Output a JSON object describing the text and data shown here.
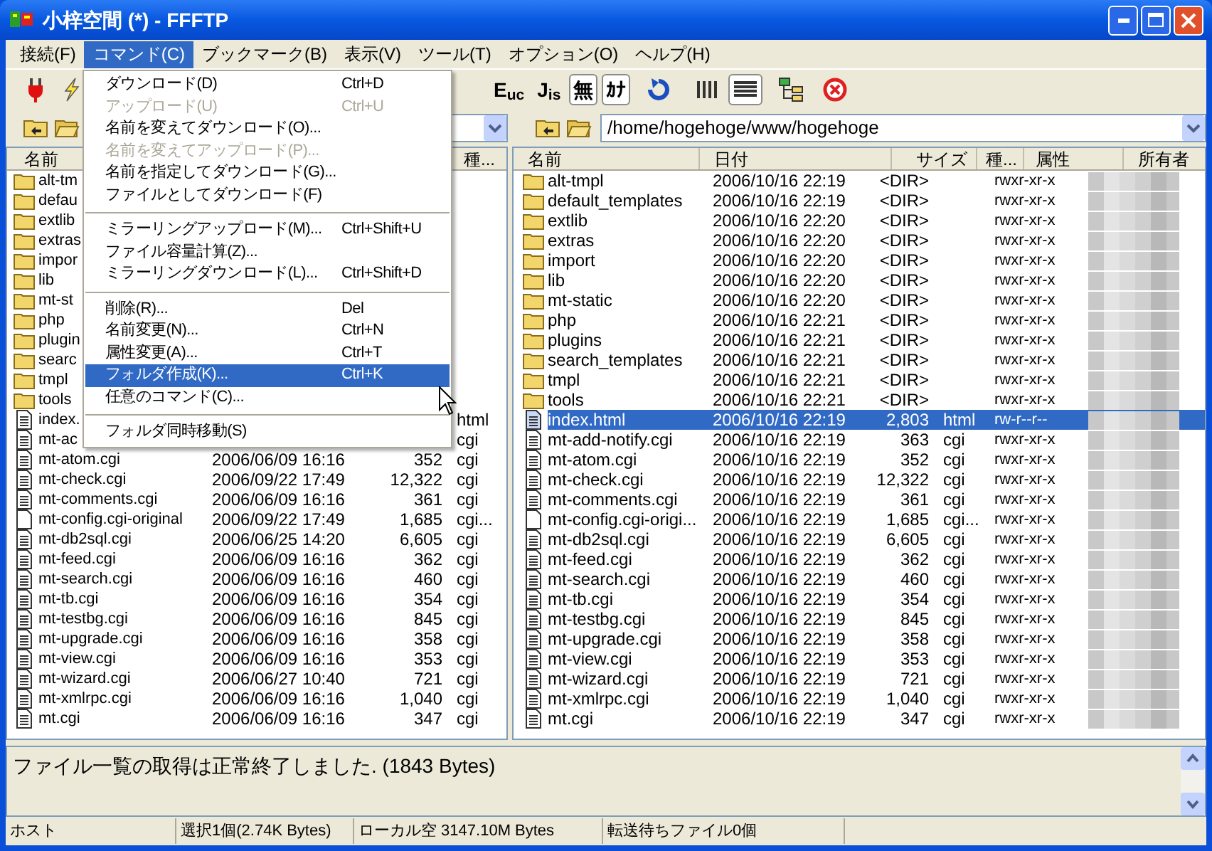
{
  "window": {
    "title": "小梓空間 (*) - FFFTP"
  },
  "menu_bar": [
    {
      "label": "接続(F)",
      "selected": false
    },
    {
      "label": "コマンド(C)",
      "selected": true
    },
    {
      "label": "ブックマーク(B)",
      "selected": false
    },
    {
      "label": "表示(V)",
      "selected": false
    },
    {
      "label": "ツール(T)",
      "selected": false
    },
    {
      "label": "オプション(O)",
      "selected": false
    },
    {
      "label": "ヘルプ(H)",
      "selected": false
    }
  ],
  "command_menu": [
    {
      "kind": "item",
      "label": "ダウンロード(D)",
      "shortcut": "Ctrl+D",
      "disabled": false,
      "selected": false
    },
    {
      "kind": "item",
      "label": "アップロード(U)",
      "shortcut": "Ctrl+U",
      "disabled": true,
      "selected": false
    },
    {
      "kind": "item",
      "label": "名前を変えてダウンロード(O)...",
      "disabled": false,
      "selected": false
    },
    {
      "kind": "item",
      "label": "名前を変えてアップロード(P)...",
      "disabled": true,
      "selected": false
    },
    {
      "kind": "item",
      "label": "名前を指定してダウンロード(G)...",
      "disabled": false,
      "selected": false
    },
    {
      "kind": "item",
      "label": "ファイルとしてダウンロード(F)",
      "disabled": false,
      "selected": false
    },
    {
      "kind": "separator"
    },
    {
      "kind": "item",
      "label": "ミラーリングアップロード(M)...",
      "shortcut": "Ctrl+Shift+U",
      "disabled": false,
      "selected": false
    },
    {
      "kind": "item",
      "label": "ファイル容量計算(Z)...",
      "disabled": false,
      "selected": false
    },
    {
      "kind": "item",
      "label": "ミラーリングダウンロード(L)...",
      "shortcut": "Ctrl+Shift+D",
      "disabled": false,
      "selected": false
    },
    {
      "kind": "separator"
    },
    {
      "kind": "item",
      "label": "削除(R)...",
      "shortcut": "Del",
      "disabled": false,
      "selected": false
    },
    {
      "kind": "item",
      "label": "名前変更(N)...",
      "shortcut": "Ctrl+N",
      "disabled": false,
      "selected": false
    },
    {
      "kind": "item",
      "label": "属性変更(A)...",
      "shortcut": "Ctrl+T",
      "disabled": false,
      "selected": false
    },
    {
      "kind": "item",
      "label": "フォルダ作成(K)...",
      "shortcut": "Ctrl+K",
      "disabled": false,
      "selected": true
    },
    {
      "kind": "item",
      "label": "任意のコマンド(C)...",
      "disabled": false,
      "selected": false
    },
    {
      "kind": "separator"
    },
    {
      "kind": "item",
      "label": "フォルダ同時移動(S)",
      "disabled": false,
      "selected": false
    }
  ],
  "encoding_buttons": [
    {
      "label": "E$_{uc}$",
      "pressed": false
    },
    {
      "label": "J$_{is}$",
      "pressed": false
    },
    {
      "label": "無",
      "pressed": true
    },
    {
      "label": "ｶﾅ",
      "pressed": true
    }
  ],
  "view_buttons": [
    {
      "kind": "list",
      "pressed": false
    },
    {
      "kind": "details",
      "pressed": true
    }
  ],
  "local_pane": {
    "columns": [
      "名前",
      "種..."
    ],
    "rows": [
      {
        "kind": "folder",
        "name": "alt-tm"
      },
      {
        "kind": "folder",
        "name": "defau"
      },
      {
        "kind": "folder",
        "name": "extlib"
      },
      {
        "kind": "folder",
        "name": "extras"
      },
      {
        "kind": "folder",
        "name": "impor"
      },
      {
        "kind": "folder",
        "name": "lib"
      },
      {
        "kind": "folder",
        "name": "mt-st"
      },
      {
        "kind": "folder",
        "name": "php"
      },
      {
        "kind": "folder",
        "name": "plugin"
      },
      {
        "kind": "folder",
        "name": "searc"
      },
      {
        "kind": "folder",
        "name": "tmpl"
      },
      {
        "kind": "folder",
        "name": "tools"
      },
      {
        "kind": "file",
        "name": "index.",
        "type": "html"
      },
      {
        "kind": "file",
        "name": "mt-ac",
        "type": "cgi"
      },
      {
        "kind": "file",
        "name": "mt-atom.cgi",
        "date": "2006/06/09 16:16",
        "size": "352",
        "type": "cgi"
      },
      {
        "kind": "file",
        "name": "mt-check.cgi",
        "date": "2006/09/22 17:49",
        "size": "12,322",
        "type": "cgi"
      },
      {
        "kind": "file",
        "name": "mt-comments.cgi",
        "date": "2006/06/09 16:16",
        "size": "361",
        "type": "cgi"
      },
      {
        "kind": "blank",
        "name": "mt-config.cgi-original",
        "date": "2006/09/22 17:49",
        "size": "1,685",
        "type": "cgi..."
      },
      {
        "kind": "file",
        "name": "mt-db2sql.cgi",
        "date": "2006/06/25 14:20",
        "size": "6,605",
        "type": "cgi"
      },
      {
        "kind": "file",
        "name": "mt-feed.cgi",
        "date": "2006/06/09 16:16",
        "size": "362",
        "type": "cgi"
      },
      {
        "kind": "file",
        "name": "mt-search.cgi",
        "date": "2006/06/09 16:16",
        "size": "460",
        "type": "cgi"
      },
      {
        "kind": "file",
        "name": "mt-tb.cgi",
        "date": "2006/06/09 16:16",
        "size": "354",
        "type": "cgi"
      },
      {
        "kind": "file",
        "name": "mt-testbg.cgi",
        "date": "2006/06/09 16:16",
        "size": "845",
        "type": "cgi"
      },
      {
        "kind": "file",
        "name": "mt-upgrade.cgi",
        "date": "2006/06/09 16:16",
        "size": "358",
        "type": "cgi"
      },
      {
        "kind": "file",
        "name": "mt-view.cgi",
        "date": "2006/06/09 16:16",
        "size": "353",
        "type": "cgi"
      },
      {
        "kind": "file",
        "name": "mt-wizard.cgi",
        "date": "2006/06/27 10:40",
        "size": "721",
        "type": "cgi"
      },
      {
        "kind": "file",
        "name": "mt-xmlrpc.cgi",
        "date": "2006/06/09 16:16",
        "size": "1,040",
        "type": "cgi"
      },
      {
        "kind": "file",
        "name": "mt.cgi",
        "date": "2006/06/09 16:16",
        "size": "347",
        "type": "cgi"
      }
    ]
  },
  "remote_pane": {
    "path": "/home/hogehoge/www/hogehoge",
    "columns": [
      "名前",
      "日付",
      "サイズ",
      "種...",
      "属性",
      "所有者"
    ],
    "rows": [
      {
        "kind": "folder",
        "name": "alt-tmpl",
        "date": "2006/10/16 22:19",
        "size": "<DIR>",
        "attr": "rwxr-xr-x",
        "selected": false
      },
      {
        "kind": "folder",
        "name": "default_templates",
        "date": "2006/10/16 22:19",
        "size": "<DIR>",
        "attr": "rwxr-xr-x",
        "selected": false
      },
      {
        "kind": "folder",
        "name": "extlib",
        "date": "2006/10/16 22:20",
        "size": "<DIR>",
        "attr": "rwxr-xr-x",
        "selected": false
      },
      {
        "kind": "folder",
        "name": "extras",
        "date": "2006/10/16 22:20",
        "size": "<DIR>",
        "attr": "rwxr-xr-x",
        "selected": false
      },
      {
        "kind": "folder",
        "name": "import",
        "date": "2006/10/16 22:20",
        "size": "<DIR>",
        "attr": "rwxr-xr-x",
        "selected": false
      },
      {
        "kind": "folder",
        "name": "lib",
        "date": "2006/10/16 22:20",
        "size": "<DIR>",
        "attr": "rwxr-xr-x",
        "selected": false
      },
      {
        "kind": "folder",
        "name": "mt-static",
        "date": "2006/10/16 22:20",
        "size": "<DIR>",
        "attr": "rwxr-xr-x",
        "selected": false
      },
      {
        "kind": "folder",
        "name": "php",
        "date": "2006/10/16 22:21",
        "size": "<DIR>",
        "attr": "rwxr-xr-x",
        "selected": false
      },
      {
        "kind": "folder",
        "name": "plugins",
        "date": "2006/10/16 22:21",
        "size": "<DIR>",
        "attr": "rwxr-xr-x",
        "selected": false
      },
      {
        "kind": "folder",
        "name": "search_templates",
        "date": "2006/10/16 22:21",
        "size": "<DIR>",
        "attr": "rwxr-xr-x",
        "selected": false
      },
      {
        "kind": "folder",
        "name": "tmpl",
        "date": "2006/10/16 22:21",
        "size": "<DIR>",
        "attr": "rwxr-xr-x",
        "selected": false
      },
      {
        "kind": "folder",
        "name": "tools",
        "date": "2006/10/16 22:21",
        "size": "<DIR>",
        "attr": "rwxr-xr-x",
        "selected": false
      },
      {
        "kind": "file",
        "name": "index.html",
        "date": "2006/10/16 22:19",
        "size": "2,803",
        "type": "html",
        "attr": "rw-r--r--",
        "selected": true
      },
      {
        "kind": "file",
        "name": "mt-add-notify.cgi",
        "date": "2006/10/16 22:19",
        "size": "363",
        "type": "cgi",
        "attr": "rwxr-xr-x",
        "selected": false
      },
      {
        "kind": "file",
        "name": "mt-atom.cgi",
        "date": "2006/10/16 22:19",
        "size": "352",
        "type": "cgi",
        "attr": "rwxr-xr-x",
        "selected": false
      },
      {
        "kind": "file",
        "name": "mt-check.cgi",
        "date": "2006/10/16 22:19",
        "size": "12,322",
        "type": "cgi",
        "attr": "rwxr-xr-x",
        "selected": false
      },
      {
        "kind": "file",
        "name": "mt-comments.cgi",
        "date": "2006/10/16 22:19",
        "size": "361",
        "type": "cgi",
        "attr": "rwxr-xr-x",
        "selected": false
      },
      {
        "kind": "blank",
        "name": "mt-config.cgi-origi...",
        "date": "2006/10/16 22:19",
        "size": "1,685",
        "type": "cgi...",
        "attr": "rwxr-xr-x",
        "selected": false
      },
      {
        "kind": "file",
        "name": "mt-db2sql.cgi",
        "date": "2006/10/16 22:19",
        "size": "6,605",
        "type": "cgi",
        "attr": "rwxr-xr-x",
        "selected": false
      },
      {
        "kind": "file",
        "name": "mt-feed.cgi",
        "date": "2006/10/16 22:19",
        "size": "362",
        "type": "cgi",
        "attr": "rwxr-xr-x",
        "selected": false
      },
      {
        "kind": "file",
        "name": "mt-search.cgi",
        "date": "2006/10/16 22:19",
        "size": "460",
        "type": "cgi",
        "attr": "rwxr-xr-x",
        "selected": false
      },
      {
        "kind": "file",
        "name": "mt-tb.cgi",
        "date": "2006/10/16 22:19",
        "size": "354",
        "type": "cgi",
        "attr": "rwxr-xr-x",
        "selected": false
      },
      {
        "kind": "file",
        "name": "mt-testbg.cgi",
        "date": "2006/10/16 22:19",
        "size": "845",
        "type": "cgi",
        "attr": "rwxr-xr-x",
        "selected": false
      },
      {
        "kind": "file",
        "name": "mt-upgrade.cgi",
        "date": "2006/10/16 22:19",
        "size": "358",
        "type": "cgi",
        "attr": "rwxr-xr-x",
        "selected": false
      },
      {
        "kind": "file",
        "name": "mt-view.cgi",
        "date": "2006/10/16 22:19",
        "size": "353",
        "type": "cgi",
        "attr": "rwxr-xr-x",
        "selected": false
      },
      {
        "kind": "file",
        "name": "mt-wizard.cgi",
        "date": "2006/10/16 22:19",
        "size": "721",
        "type": "cgi",
        "attr": "rwxr-xr-x",
        "selected": false
      },
      {
        "kind": "file",
        "name": "mt-xmlrpc.cgi",
        "date": "2006/10/16 22:19",
        "size": "1,040",
        "type": "cgi",
        "attr": "rwxr-xr-x",
        "selected": false
      },
      {
        "kind": "file",
        "name": "mt.cgi",
        "date": "2006/10/16 22:19",
        "size": "347",
        "type": "cgi",
        "attr": "rwxr-xr-x",
        "selected": false
      }
    ]
  },
  "log": {
    "message": "ファイル一覧の取得は正常終了しました. (1843 Bytes)"
  },
  "status_bar": [
    "ホスト",
    "選択1個(2.74K Bytes)",
    "ローカル空 3147.10M Bytes",
    "転送待ちファイル0個"
  ]
}
